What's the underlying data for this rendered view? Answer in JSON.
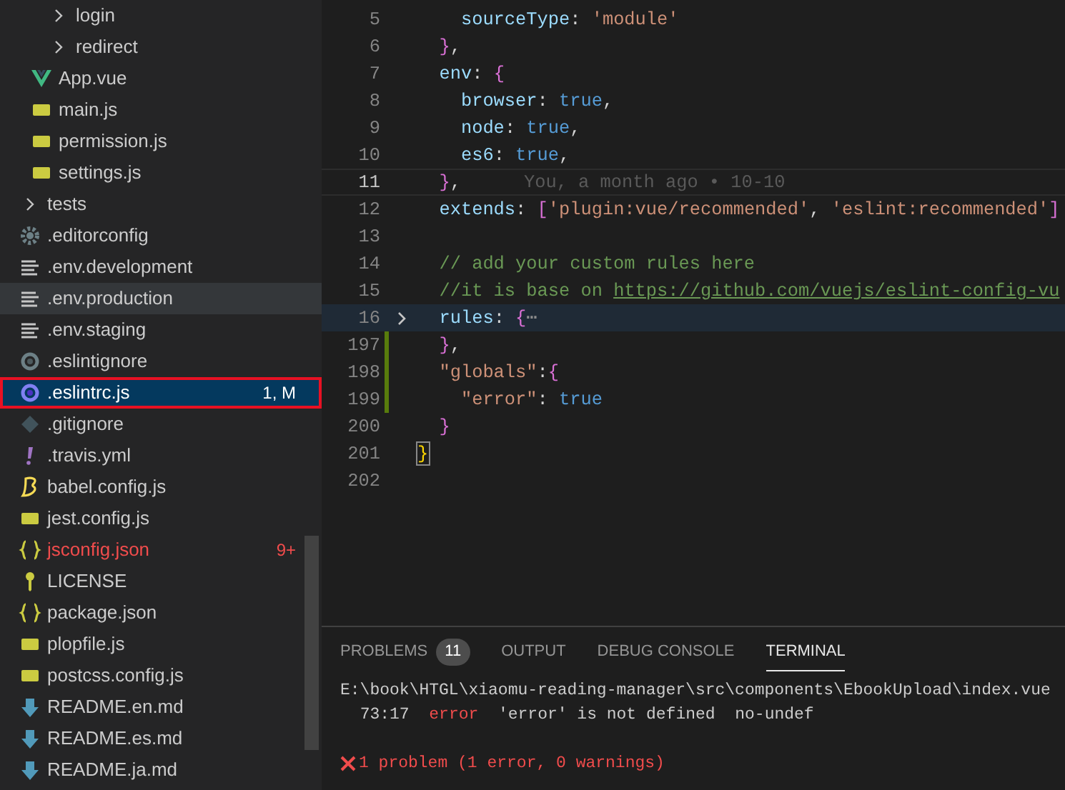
{
  "explorer": {
    "nested_items": [
      {
        "kind": "folder",
        "label": "login",
        "expanded": false,
        "selected": false,
        "hovered": false,
        "outlined": false
      },
      {
        "kind": "folder",
        "label": "redirect",
        "expanded": false,
        "selected": false,
        "hovered": false,
        "outlined": false
      }
    ],
    "folder_items": [
      {
        "kind": "vue",
        "label": "App.vue",
        "selected": false,
        "hovered": false,
        "outlined": false
      },
      {
        "kind": "js",
        "label": "main.js",
        "selected": false,
        "hovered": false,
        "outlined": false
      },
      {
        "kind": "js",
        "label": "permission.js",
        "selected": false,
        "hovered": false,
        "outlined": false
      },
      {
        "kind": "js",
        "label": "settings.js",
        "selected": false,
        "hovered": false,
        "outlined": false
      }
    ],
    "root_items": [
      {
        "kind": "folder",
        "label": "tests",
        "expanded": false,
        "selected": false,
        "hovered": false,
        "outlined": false
      },
      {
        "kind": "config",
        "label": ".editorconfig",
        "selected": false,
        "hovered": false,
        "outlined": false
      },
      {
        "kind": "env",
        "label": ".env.development",
        "selected": false,
        "hovered": false,
        "outlined": false
      },
      {
        "kind": "env",
        "label": ".env.production",
        "selected": false,
        "hovered": true,
        "outlined": false
      },
      {
        "kind": "env",
        "label": ".env.staging",
        "selected": false,
        "hovered": false,
        "outlined": false
      },
      {
        "kind": "ignore",
        "label": ".eslintignore",
        "selected": false,
        "hovered": false,
        "outlined": false
      },
      {
        "kind": "eslint",
        "label": ".eslintrc.js",
        "selected": true,
        "hovered": false,
        "outlined": true,
        "badge": "1, M"
      },
      {
        "kind": "git",
        "label": ".gitignore",
        "selected": false,
        "hovered": false,
        "outlined": false
      },
      {
        "kind": "travis",
        "label": ".travis.yml",
        "selected": false,
        "hovered": false,
        "outlined": false
      },
      {
        "kind": "babel",
        "label": "babel.config.js",
        "selected": false,
        "hovered": false,
        "outlined": false
      },
      {
        "kind": "js",
        "label": "jest.config.js",
        "selected": false,
        "hovered": false,
        "outlined": false
      },
      {
        "kind": "json",
        "label": "jsconfig.json",
        "selected": false,
        "hovered": false,
        "outlined": false,
        "color": "#f14c4c",
        "badge": "9+"
      },
      {
        "kind": "license",
        "label": "LICENSE",
        "selected": false,
        "hovered": false,
        "outlined": false
      },
      {
        "kind": "json",
        "label": "package.json",
        "selected": false,
        "hovered": false,
        "outlined": false
      },
      {
        "kind": "js",
        "label": "plopfile.js",
        "selected": false,
        "hovered": false,
        "outlined": false
      },
      {
        "kind": "js",
        "label": "postcss.config.js",
        "selected": false,
        "hovered": false,
        "outlined": false
      },
      {
        "kind": "markdown",
        "label": "README.en.md",
        "selected": false,
        "hovered": false,
        "outlined": false
      },
      {
        "kind": "markdown",
        "label": "README.es.md",
        "selected": false,
        "hovered": false,
        "outlined": false
      },
      {
        "kind": "markdown",
        "label": "README.ja.md",
        "selected": false,
        "hovered": false,
        "outlined": false
      }
    ]
  },
  "editor": {
    "lines": [
      {
        "number": "5",
        "current": false,
        "folded": false,
        "git_added": false,
        "text": "    sourceType: 'module'"
      },
      {
        "number": "6",
        "current": false,
        "folded": false,
        "git_added": false,
        "text": "  },"
      },
      {
        "number": "7",
        "current": false,
        "folded": false,
        "git_added": false,
        "text": "  env: {"
      },
      {
        "number": "8",
        "current": false,
        "folded": false,
        "git_added": false,
        "text": "    browser: true,"
      },
      {
        "number": "9",
        "current": false,
        "folded": false,
        "git_added": false,
        "text": "    node: true,"
      },
      {
        "number": "10",
        "current": false,
        "folded": false,
        "git_added": false,
        "text": "    es6: true,"
      },
      {
        "number": "11",
        "current": true,
        "folded": false,
        "git_added": false,
        "text": "  },",
        "blame": "You, a month ago • 10-10"
      },
      {
        "number": "12",
        "current": false,
        "folded": false,
        "git_added": false,
        "text": "  extends: ['plugin:vue/recommended', 'eslint:recommended']"
      },
      {
        "number": "13",
        "current": false,
        "folded": false,
        "git_added": false
      },
      {
        "number": "14",
        "current": false,
        "folded": false,
        "git_added": false,
        "text": "  // add your custom rules here"
      },
      {
        "number": "15",
        "current": false,
        "folded": false,
        "git_added": false,
        "text": "  //it is base on https://github.com/vuejs/eslint-config-vu"
      },
      {
        "number": "16",
        "current": false,
        "folded": true,
        "git_added": false,
        "text": "  rules: {⋯"
      },
      {
        "number": "197",
        "current": false,
        "folded": false,
        "git_added": true,
        "text": "  },"
      },
      {
        "number": "198",
        "current": false,
        "folded": false,
        "git_added": true,
        "text": "  \"globals\":{"
      },
      {
        "number": "199",
        "current": false,
        "folded": false,
        "git_added": true,
        "text": "    \"error\": true"
      },
      {
        "number": "200",
        "current": false,
        "folded": false,
        "git_added": false,
        "text": "  }"
      },
      {
        "number": "201",
        "current": false,
        "folded": false,
        "git_added": false,
        "text": "}"
      },
      {
        "number": "202",
        "current": false,
        "folded": false,
        "git_added": false
      }
    ]
  },
  "panel": {
    "tabs": [
      {
        "label": "PROBLEMS",
        "badge": "11",
        "selected": false
      },
      {
        "label": "OUTPUT",
        "selected": false
      },
      {
        "label": "DEBUG CONSOLE",
        "selected": false
      },
      {
        "label": "TERMINAL",
        "selected": true
      }
    ],
    "terminal": [
      {
        "kind": "path",
        "text": "E:\\book\\HTGL\\xiaomu-reading-manager\\src\\components\\EbookUpload\\index.vue"
      },
      {
        "kind": "problem",
        "location": "73:17",
        "severity": "error",
        "message": "'error' is not defined",
        "rule": "no-undef"
      },
      {
        "kind": "blank"
      },
      {
        "kind": "summary",
        "text": "1 problem (1 error, 0 warnings)"
      }
    ]
  }
}
